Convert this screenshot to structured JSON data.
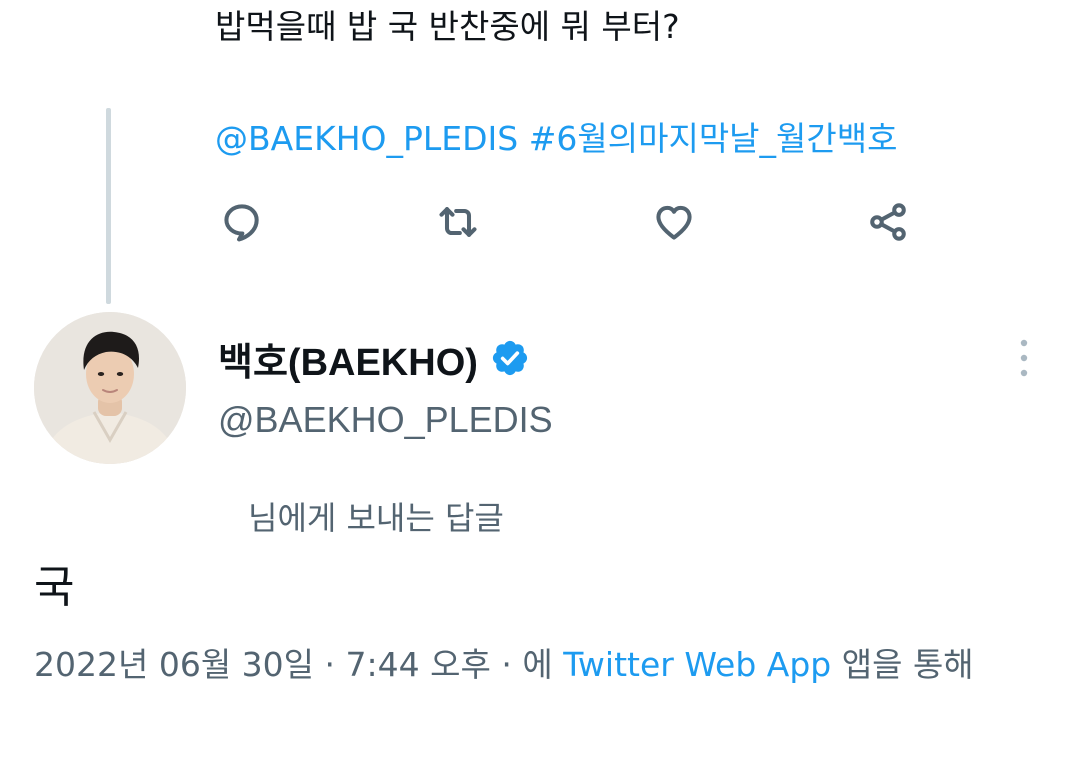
{
  "parent_tweet": {
    "text": "밥먹을때 밥 국 반찬중에 뭐 부터?",
    "mention": "@BAEKHO_PLEDIS",
    "hashtag": "#6월의마지막날_월간백호",
    "actions": [
      {
        "name": "reply",
        "icon": "comment-icon"
      },
      {
        "name": "retweet",
        "icon": "retweet-icon"
      },
      {
        "name": "like",
        "icon": "heart-icon"
      },
      {
        "name": "share",
        "icon": "share-icon"
      }
    ]
  },
  "reply_tweet": {
    "display_name": "백호(BAEKHO)",
    "verified": true,
    "handle": "@BAEKHO_PLEDIS",
    "reply_context": "님에게 보내는 답글",
    "text": "국",
    "meta": {
      "date": "2022년 06월 30일",
      "separator": "·",
      "time": "7:44 오후",
      "via_prefix": "에",
      "app": "Twitter Web App",
      "via_suffix": "앱을 통해"
    }
  },
  "colors": {
    "accent": "#1d9bf0",
    "text_primary": "#0f1419",
    "text_secondary": "#536471",
    "thread_line": "#cfd9de"
  }
}
